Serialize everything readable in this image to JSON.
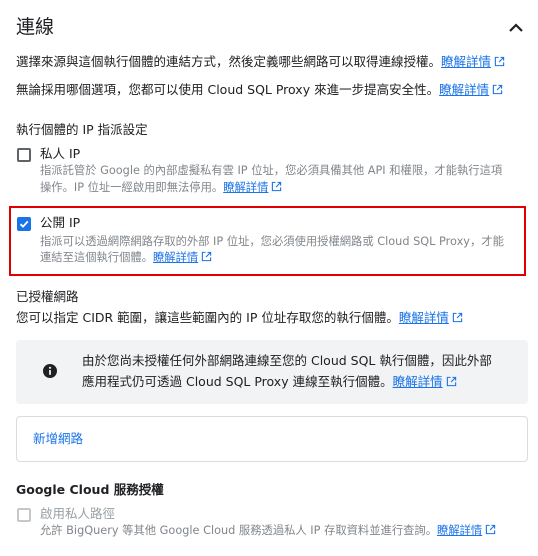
{
  "section": {
    "title": "連線",
    "desc1": "選擇來源與這個執行個體的連結方式，然後定義哪些網路可以取得連線授權。",
    "desc2": "無論採用哪個選項，您都可以使用 Cloud SQL Proxy 來進一步提高安全性。",
    "learn_more": "瞭解詳情"
  },
  "ip_assignment": {
    "heading": "執行個體的 IP 指派設定",
    "private_ip": {
      "label": "私人 IP",
      "help_line1": "指派託管於 Google 的內部虛擬私有雲 IP 位址，您必須具備其他 API 和權限，才能執行這項",
      "help_line2": "操作。IP 位址一經啟用即無法停用。",
      "checked": false
    },
    "public_ip": {
      "label": "公開 IP",
      "help_line1": "指派可以透過網際網路存取的外部 IP 位址，您必須使用授權網路或 Cloud SQL Proxy，才能",
      "help_line2": "連結至這個執行個體。",
      "checked": true
    }
  },
  "authorized_networks": {
    "heading": "已授權網路",
    "desc": "您可以指定 CIDR 範圍，讓這些範圍內的 IP 位址存取您的執行個體。",
    "info_line1": "由於您尚未授權任何外部網路連線至您的 Cloud SQL 執行個體，因此外部",
    "info_line2": "應用程式仍可透過 Cloud SQL Proxy 連線至執行個體。",
    "add_network": "新增網路"
  },
  "gcp_auth": {
    "heading": "Google Cloud 服務授權",
    "private_path_label": "啟用私人路徑",
    "private_path_help": "允許 BigQuery 等其他 Google Cloud 服務透過私人 IP 存取資料並進行查詢。"
  },
  "colors": {
    "link": "#1a73e8",
    "checkbox": "#1a73e8",
    "highlight": "#e00000"
  },
  "icons": [
    "chevron-up-icon",
    "external-link-icon",
    "info-icon"
  ]
}
